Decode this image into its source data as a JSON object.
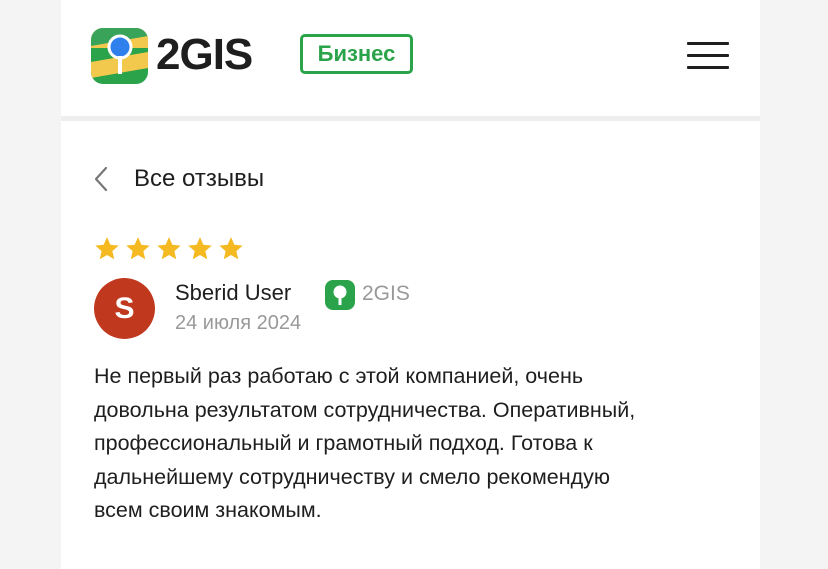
{
  "header": {
    "logo_text": "2GIS",
    "badge": "Бизнес",
    "menu_icon": "hamburger-menu-icon"
  },
  "nav": {
    "back_icon": "chevron-left-icon",
    "title": "Все отзывы"
  },
  "review": {
    "rating": 5,
    "rating_max": 5,
    "avatar_letter": "S",
    "author": "Sberid User",
    "source_icon": "2gis-icon",
    "source": "2GIS",
    "date": "24 июля 2024",
    "text_lines": [
      "Не первый раз работаю с этой компанией, очень",
      "довольна результатом сотрудничества. Оперативный,",
      "профессиональный и грамотный подход. Готова к",
      "дальнейшему сотрудничеству и смело рекомендую",
      "всем своим знакомым."
    ]
  },
  "colors": {
    "brand_green": "#2aa34a",
    "star": "#f5b921",
    "avatar_bg": "#c0391f",
    "muted_text": "#999999",
    "text": "#1e1e1e"
  }
}
